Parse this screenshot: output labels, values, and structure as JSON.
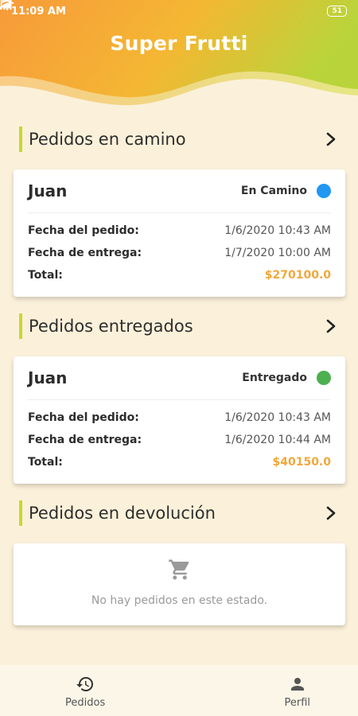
{
  "status_bar": {
    "time": "11:09 AM",
    "battery": "51"
  },
  "app": {
    "title": "Super Frutti"
  },
  "sections": [
    {
      "title": "Pedidos en camino",
      "order": {
        "name": "Juan",
        "status": "En Camino",
        "status_color": "#2196f3",
        "order_date_label": "Fecha del pedido:",
        "order_date": "1/6/2020 10:43 AM",
        "delivery_date_label": "Fecha de entrega:",
        "delivery_date": "1/7/2020 10:00 AM",
        "total_label": "Total:",
        "total": "$270100.0"
      }
    },
    {
      "title": "Pedidos entregados",
      "order": {
        "name": "Juan",
        "status": "Entregado",
        "status_color": "#4caf50",
        "order_date_label": "Fecha del pedido:",
        "order_date": "1/6/2020 10:43 AM",
        "delivery_date_label": "Fecha de entrega:",
        "delivery_date": "1/6/2020 10:44 AM",
        "total_label": "Total:",
        "total": "$40150.0"
      }
    },
    {
      "title": "Pedidos en devolución",
      "empty_message": "No hay pedidos en este estado."
    }
  ],
  "bottom_nav": {
    "items": [
      {
        "label": "Pedidos",
        "icon": "history-icon"
      },
      {
        "label": "Perfil",
        "icon": "person-icon"
      }
    ]
  },
  "colors": {
    "accent_bar": "#c5d92e",
    "total": "#f2a73a",
    "background": "#fbf1da"
  }
}
